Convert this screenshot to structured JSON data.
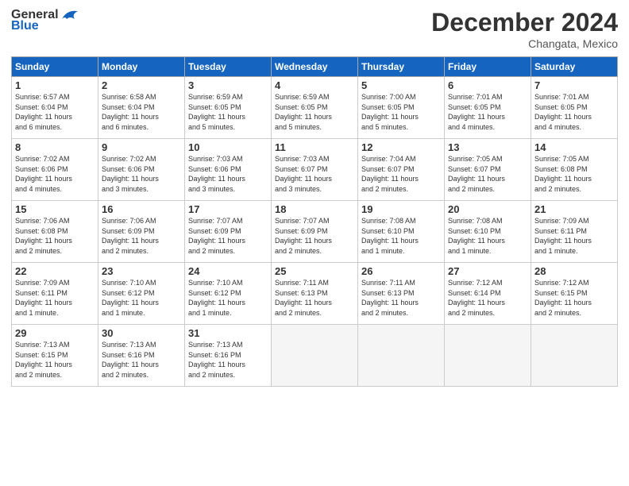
{
  "header": {
    "logo_general": "General",
    "logo_blue": "Blue",
    "month": "December 2024",
    "location": "Changata, Mexico"
  },
  "days_of_week": [
    "Sunday",
    "Monday",
    "Tuesday",
    "Wednesday",
    "Thursday",
    "Friday",
    "Saturday"
  ],
  "weeks": [
    [
      {
        "day": "1",
        "info": "Sunrise: 6:57 AM\nSunset: 6:04 PM\nDaylight: 11 hours\nand 6 minutes."
      },
      {
        "day": "2",
        "info": "Sunrise: 6:58 AM\nSunset: 6:04 PM\nDaylight: 11 hours\nand 6 minutes."
      },
      {
        "day": "3",
        "info": "Sunrise: 6:59 AM\nSunset: 6:05 PM\nDaylight: 11 hours\nand 5 minutes."
      },
      {
        "day": "4",
        "info": "Sunrise: 6:59 AM\nSunset: 6:05 PM\nDaylight: 11 hours\nand 5 minutes."
      },
      {
        "day": "5",
        "info": "Sunrise: 7:00 AM\nSunset: 6:05 PM\nDaylight: 11 hours\nand 5 minutes."
      },
      {
        "day": "6",
        "info": "Sunrise: 7:01 AM\nSunset: 6:05 PM\nDaylight: 11 hours\nand 4 minutes."
      },
      {
        "day": "7",
        "info": "Sunrise: 7:01 AM\nSunset: 6:05 PM\nDaylight: 11 hours\nand 4 minutes."
      }
    ],
    [
      {
        "day": "8",
        "info": "Sunrise: 7:02 AM\nSunset: 6:06 PM\nDaylight: 11 hours\nand 4 minutes."
      },
      {
        "day": "9",
        "info": "Sunrise: 7:02 AM\nSunset: 6:06 PM\nDaylight: 11 hours\nand 3 minutes."
      },
      {
        "day": "10",
        "info": "Sunrise: 7:03 AM\nSunset: 6:06 PM\nDaylight: 11 hours\nand 3 minutes."
      },
      {
        "day": "11",
        "info": "Sunrise: 7:03 AM\nSunset: 6:07 PM\nDaylight: 11 hours\nand 3 minutes."
      },
      {
        "day": "12",
        "info": "Sunrise: 7:04 AM\nSunset: 6:07 PM\nDaylight: 11 hours\nand 2 minutes."
      },
      {
        "day": "13",
        "info": "Sunrise: 7:05 AM\nSunset: 6:07 PM\nDaylight: 11 hours\nand 2 minutes."
      },
      {
        "day": "14",
        "info": "Sunrise: 7:05 AM\nSunset: 6:08 PM\nDaylight: 11 hours\nand 2 minutes."
      }
    ],
    [
      {
        "day": "15",
        "info": "Sunrise: 7:06 AM\nSunset: 6:08 PM\nDaylight: 11 hours\nand 2 minutes."
      },
      {
        "day": "16",
        "info": "Sunrise: 7:06 AM\nSunset: 6:09 PM\nDaylight: 11 hours\nand 2 minutes."
      },
      {
        "day": "17",
        "info": "Sunrise: 7:07 AM\nSunset: 6:09 PM\nDaylight: 11 hours\nand 2 minutes."
      },
      {
        "day": "18",
        "info": "Sunrise: 7:07 AM\nSunset: 6:09 PM\nDaylight: 11 hours\nand 2 minutes."
      },
      {
        "day": "19",
        "info": "Sunrise: 7:08 AM\nSunset: 6:10 PM\nDaylight: 11 hours\nand 1 minute."
      },
      {
        "day": "20",
        "info": "Sunrise: 7:08 AM\nSunset: 6:10 PM\nDaylight: 11 hours\nand 1 minute."
      },
      {
        "day": "21",
        "info": "Sunrise: 7:09 AM\nSunset: 6:11 PM\nDaylight: 11 hours\nand 1 minute."
      }
    ],
    [
      {
        "day": "22",
        "info": "Sunrise: 7:09 AM\nSunset: 6:11 PM\nDaylight: 11 hours\nand 1 minute."
      },
      {
        "day": "23",
        "info": "Sunrise: 7:10 AM\nSunset: 6:12 PM\nDaylight: 11 hours\nand 1 minute."
      },
      {
        "day": "24",
        "info": "Sunrise: 7:10 AM\nSunset: 6:12 PM\nDaylight: 11 hours\nand 1 minute."
      },
      {
        "day": "25",
        "info": "Sunrise: 7:11 AM\nSunset: 6:13 PM\nDaylight: 11 hours\nand 2 minutes."
      },
      {
        "day": "26",
        "info": "Sunrise: 7:11 AM\nSunset: 6:13 PM\nDaylight: 11 hours\nand 2 minutes."
      },
      {
        "day": "27",
        "info": "Sunrise: 7:12 AM\nSunset: 6:14 PM\nDaylight: 11 hours\nand 2 minutes."
      },
      {
        "day": "28",
        "info": "Sunrise: 7:12 AM\nSunset: 6:15 PM\nDaylight: 11 hours\nand 2 minutes."
      }
    ],
    [
      {
        "day": "29",
        "info": "Sunrise: 7:13 AM\nSunset: 6:15 PM\nDaylight: 11 hours\nand 2 minutes."
      },
      {
        "day": "30",
        "info": "Sunrise: 7:13 AM\nSunset: 6:16 PM\nDaylight: 11 hours\nand 2 minutes."
      },
      {
        "day": "31",
        "info": "Sunrise: 7:13 AM\nSunset: 6:16 PM\nDaylight: 11 hours\nand 2 minutes."
      },
      null,
      null,
      null,
      null
    ]
  ]
}
